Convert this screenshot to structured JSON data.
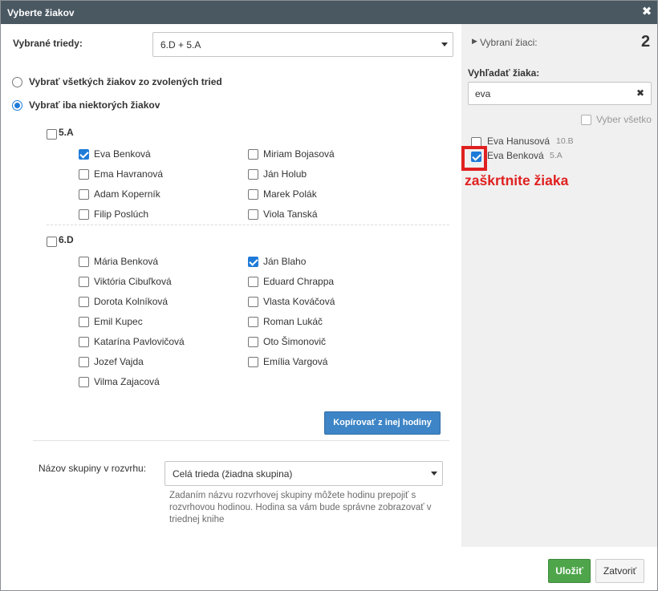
{
  "dialog": {
    "title": "Vyberte žiakov",
    "close_glyph": "✖"
  },
  "classes": {
    "label": "Vybrané triedy:",
    "selected": "6.D + 5.A"
  },
  "mode": {
    "all_label": "Vybrať všetkých žiakov zo zvolených tried",
    "some_label": "Vybrať iba niektorých žiakov",
    "selected": "some"
  },
  "groups": [
    {
      "name": "5.A",
      "checked": false,
      "students": [
        {
          "name": "Eva Benková",
          "checked": true
        },
        {
          "name": "Miriam Bojasová",
          "checked": false
        },
        {
          "name": "Ema Havranová",
          "checked": false
        },
        {
          "name": "Ján Holub",
          "checked": false
        },
        {
          "name": "Adam Koperník",
          "checked": false
        },
        {
          "name": "Marek Polák",
          "checked": false
        },
        {
          "name": "Filip Poslúch",
          "checked": false
        },
        {
          "name": "Viola Tanská",
          "checked": false
        }
      ]
    },
    {
      "name": "6.D",
      "checked": false,
      "students": [
        {
          "name": "Mária Benková",
          "checked": false
        },
        {
          "name": "Ján Blaho",
          "checked": true
        },
        {
          "name": "Viktória Cibuľková",
          "checked": false
        },
        {
          "name": "Eduard Chrappa",
          "checked": false
        },
        {
          "name": "Dorota Kolníková",
          "checked": false
        },
        {
          "name": "Vlasta Kováčová",
          "checked": false
        },
        {
          "name": "Emil Kupec",
          "checked": false
        },
        {
          "name": "Roman Lukáč",
          "checked": false
        },
        {
          "name": "Katarína Pavlovičová",
          "checked": false
        },
        {
          "name": "Oto Šimonovič",
          "checked": false
        },
        {
          "name": "Jozef Vajda",
          "checked": false
        },
        {
          "name": "Emília Vargová",
          "checked": false
        },
        {
          "name": "Vilma Zajacová",
          "checked": false
        }
      ]
    }
  ],
  "copy_button": "Kopírovať z inej hodiny",
  "group_name": {
    "label": "Názov skupiny v rozvrhu:",
    "selected": "Celá trieda (žiadna skupina)",
    "hint": "Zadaním názvu rozvrhovej skupiny môžete hodinu prepojiť s rozvrhovou hodinou. Hodina sa vám bude správne zobrazovať v triednej knihe"
  },
  "right": {
    "selected_label": "Vybraní žiaci:",
    "selected_count": "2",
    "search_label": "Vyhľadať žiaka:",
    "search_value": "eva",
    "clear_glyph": "✖",
    "select_all_label": "Vyber všetko",
    "results": [
      {
        "name": "Eva Hanusová",
        "class": "10.B",
        "checked": false
      },
      {
        "name": "Eva Benková",
        "class": "5.A",
        "checked": true
      }
    ],
    "annotation": "zaškrtnite žiaka",
    "annotation_color": "#e02020"
  },
  "footer": {
    "save": "Uložiť",
    "close": "Zatvoriť"
  },
  "colors": {
    "titlebar": "#4a5862",
    "accent": "#1f7bd8",
    "primary_button": "#3d85c6",
    "save_button": "#4ea54a"
  }
}
